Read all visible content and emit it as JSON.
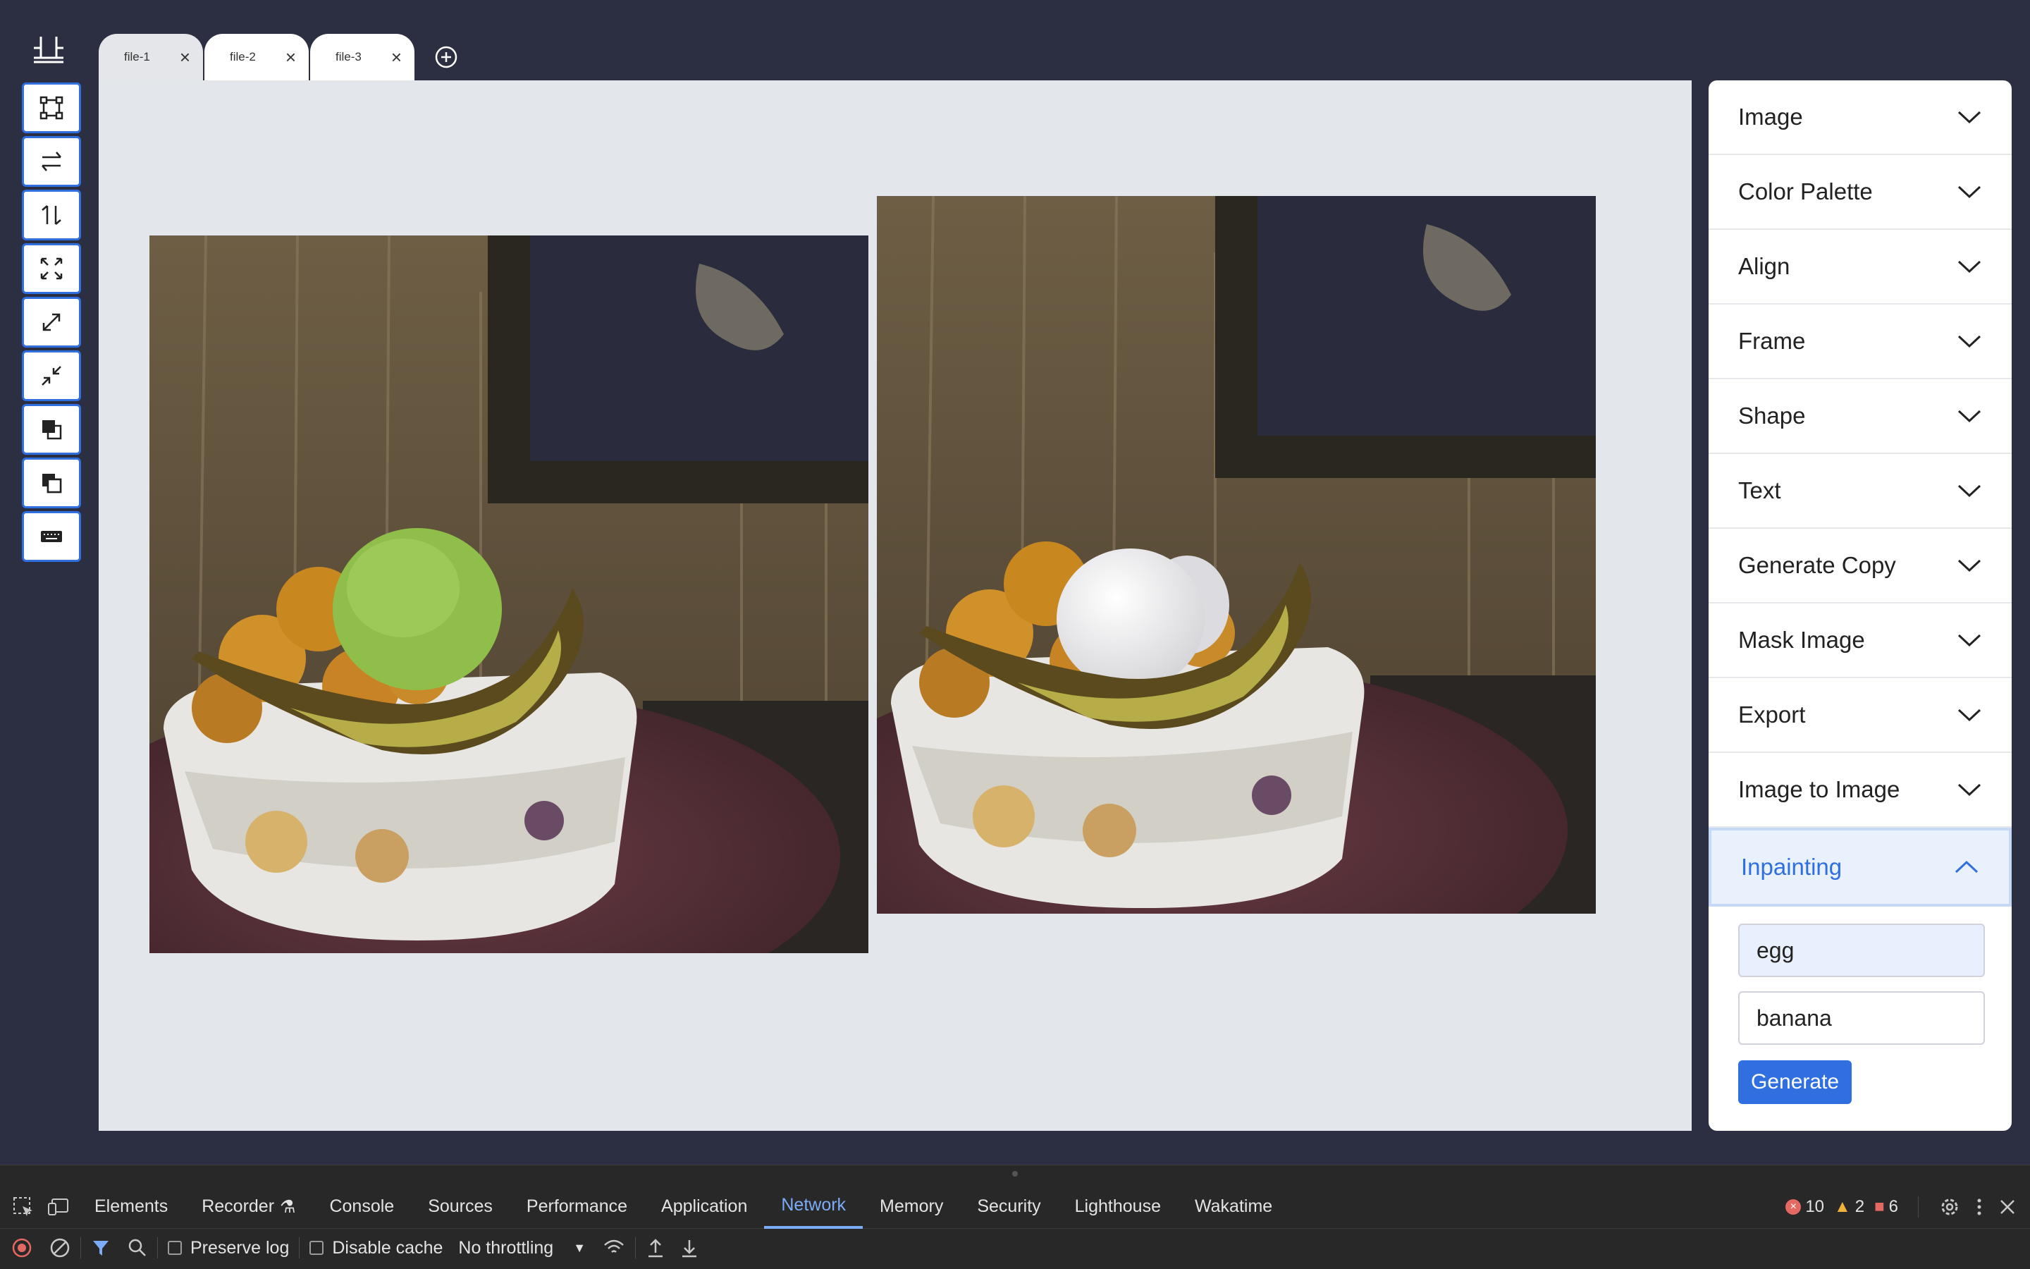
{
  "tabs": [
    {
      "label": "file-1",
      "active": false
    },
    {
      "label": "file-2",
      "active": true
    },
    {
      "label": "file-3",
      "active": true
    }
  ],
  "toolbar": {
    "tools": [
      "selection-box-icon",
      "flip-horizontal-icon",
      "flip-vertical-icon",
      "fit-screen-icon",
      "expand-icon",
      "shrink-icon",
      "bring-forward-icon",
      "send-backward-icon",
      "keyboard-icon"
    ]
  },
  "panel": {
    "sections": [
      {
        "label": "Image"
      },
      {
        "label": "Color Palette"
      },
      {
        "label": "Align"
      },
      {
        "label": "Frame"
      },
      {
        "label": "Shape"
      },
      {
        "label": "Text"
      },
      {
        "label": "Generate Copy"
      },
      {
        "label": "Mask Image"
      },
      {
        "label": "Export"
      },
      {
        "label": "Image to Image"
      }
    ],
    "inpainting": {
      "label": "Inpainting",
      "field_1": "egg",
      "field_2": "banana",
      "generate_label": "Generate"
    }
  },
  "devtools": {
    "tabs": [
      "Elements",
      "Recorder",
      "Console",
      "Sources",
      "Performance",
      "Application",
      "Network",
      "Memory",
      "Security",
      "Lighthouse",
      "Wakatime"
    ],
    "active_tab": "Network",
    "errors": "10",
    "warnings": "2",
    "issues": "6",
    "preserve_log": "Preserve log",
    "disable_cache": "Disable cache",
    "throttling": "No throttling"
  },
  "colors": {
    "accent": "#2f6fe0",
    "app_background": "#2c2e42",
    "canvas_background": "#e3e6ea"
  }
}
